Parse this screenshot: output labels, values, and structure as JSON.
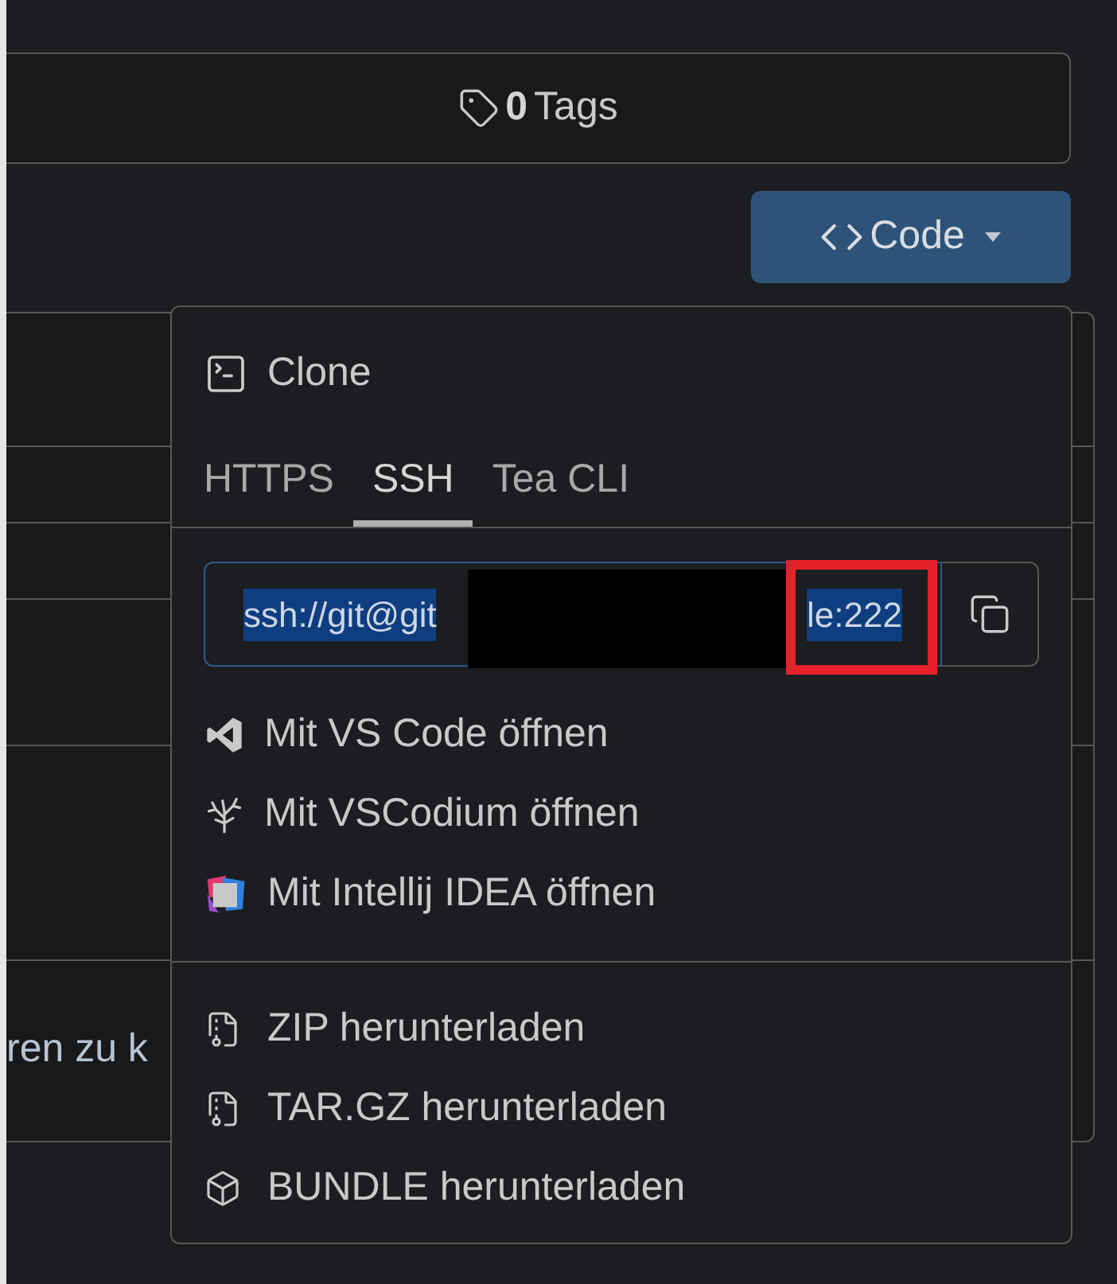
{
  "tags_bar": {
    "count": "0",
    "label": "Tags"
  },
  "code_button": {
    "label": "Code"
  },
  "background_text": "ren zu k",
  "clone_menu": {
    "title": "Clone",
    "tabs": [
      {
        "label": "HTTPS",
        "selected": false
      },
      {
        "label": "SSH",
        "selected": true
      },
      {
        "label": "Tea CLI",
        "selected": false
      }
    ],
    "url_field": {
      "value_start": "ssh://git@git",
      "value_end": "le:222",
      "selected": true
    },
    "open_with": [
      {
        "kind": "vscode",
        "label": "Mit VS Code öffnen"
      },
      {
        "kind": "vscodium",
        "label": "Mit VSCodium öffnen"
      },
      {
        "kind": "intellij",
        "label": "Mit Intellij IDEA öffnen"
      }
    ],
    "downloads": [
      {
        "kind": "archive",
        "label": "ZIP herunterladen"
      },
      {
        "kind": "archive",
        "label": "TAR.GZ herunterladen"
      },
      {
        "kind": "bundle",
        "label": "BUNDLE herunterladen"
      }
    ]
  }
}
